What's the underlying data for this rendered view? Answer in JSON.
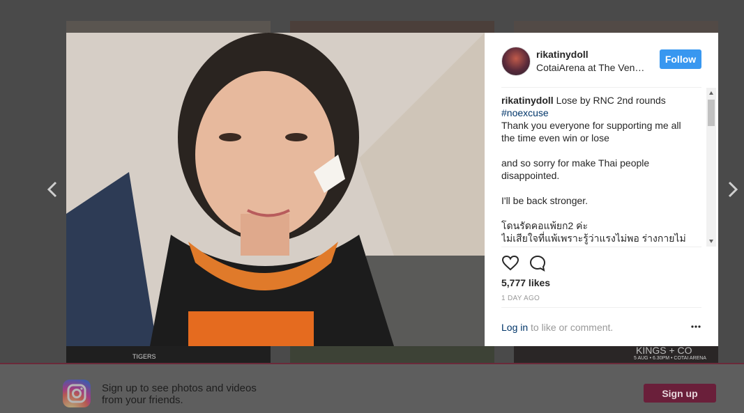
{
  "background": {
    "tile_bottom_left_text": "TIGERS",
    "tile_bottom_right_text": "KINGS + CO",
    "tile_bottom_right_subtext": "5 AUG • 6.30PM • COTAI ARENA"
  },
  "nav": {
    "prev_icon": "chevron-left-icon",
    "next_icon": "chevron-right-icon"
  },
  "post": {
    "photo_alt": "selfie photo",
    "header": {
      "username": "rikatinydoll",
      "location": "CotaiArena at The Venetian Macao",
      "follow_label": "Follow"
    },
    "caption": {
      "username": "rikatinydoll",
      "first_line": "Lose by RNC 2nd rounds",
      "hashtag": "#noexcuse",
      "lines": [
        "Thank you everyone for supporting me all",
        "the time even win or lose",
        "",
        "and so sorry for make Thai people",
        "disappointed.",
        "",
        "I'll be back stronger.",
        "",
        "โดนรัดคอแพ้ยก2 ค่ะ",
        "ไม่เสียใจที่แพ้เพราะรู้ว่าแรงไม่พอ ร่างกายไม่"
      ]
    },
    "actions": {
      "like_icon": "heart-icon",
      "comment_icon": "comment-bubble-icon"
    },
    "likes_text": "5,777 likes",
    "time_text": "1 DAY AGO",
    "login": {
      "link": "Log in",
      "rest": " to like or comment."
    },
    "more_icon": "more-options-icon"
  },
  "signup_bar": {
    "line1": "Sign up to see photos and videos",
    "line2": "from your friends.",
    "button_label": "Sign up"
  },
  "colors": {
    "follow_blue": "#3897f0",
    "link_blue": "#003569",
    "signup_button": "#6a1f3a"
  }
}
